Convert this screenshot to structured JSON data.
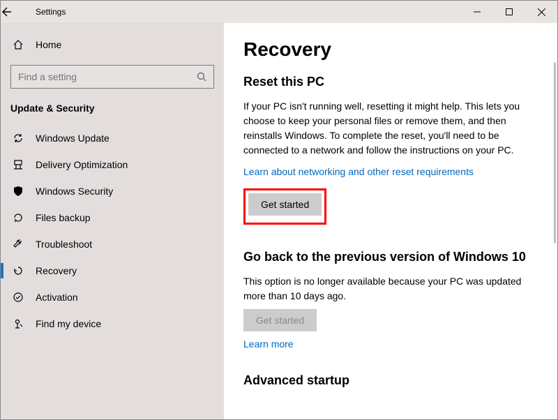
{
  "titlebar": {
    "title": "Settings"
  },
  "sidebar": {
    "home": "Home",
    "search_placeholder": "Find a setting",
    "category": "Update & Security",
    "items": [
      {
        "label": "Windows Update"
      },
      {
        "label": "Delivery Optimization"
      },
      {
        "label": "Windows Security"
      },
      {
        "label": "Files backup"
      },
      {
        "label": "Troubleshoot"
      },
      {
        "label": "Recovery"
      },
      {
        "label": "Activation"
      },
      {
        "label": "Find my device"
      }
    ]
  },
  "main": {
    "page_title": "Recovery",
    "reset": {
      "heading": "Reset this PC",
      "desc": "If your PC isn't running well, resetting it might help. This lets you choose to keep your personal files or remove them, and then reinstalls Windows. To complete the reset, you'll need to be connected to a network and follow the instructions on your PC.",
      "link": "Learn about networking and other reset requirements",
      "button": "Get started"
    },
    "goback": {
      "heading": "Go back to the previous version of Windows 10",
      "desc": "This option is no longer available because your PC was updated more than 10 days ago.",
      "button": "Get started",
      "link": "Learn more"
    },
    "advanced": {
      "heading": "Advanced startup"
    }
  }
}
